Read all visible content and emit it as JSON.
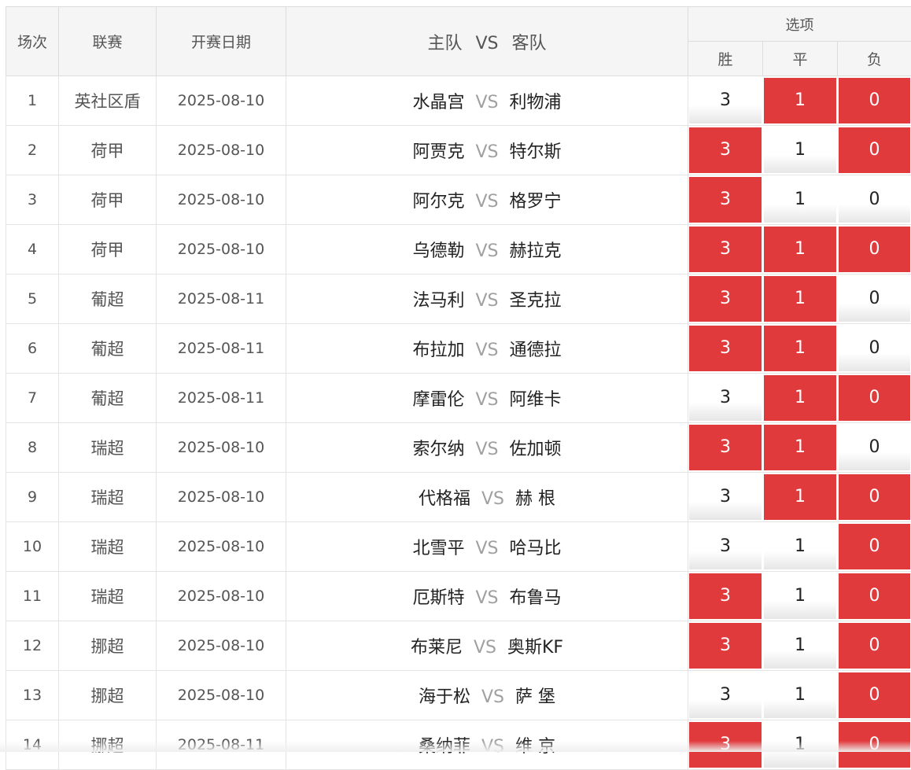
{
  "header": {
    "round": "场次",
    "league": "联赛",
    "date": "开赛日期",
    "match_home": "主队",
    "match_vs": "VS",
    "match_away": "客队",
    "options": "选项",
    "win": "胜",
    "draw": "平",
    "lose": "负"
  },
  "rows": [
    {
      "no": "1",
      "league": "英社区盾",
      "date": "2025-08-10",
      "home": "水晶宫",
      "vs": "VS",
      "away": "利物浦",
      "win": "3",
      "draw": "1",
      "lose": "0",
      "win_selected": false,
      "draw_selected": true,
      "lose_selected": true
    },
    {
      "no": "2",
      "league": "荷甲",
      "date": "2025-08-10",
      "home": "阿贾克",
      "vs": "VS",
      "away": "特尔斯",
      "win": "3",
      "draw": "1",
      "lose": "0",
      "win_selected": true,
      "draw_selected": false,
      "lose_selected": true
    },
    {
      "no": "3",
      "league": "荷甲",
      "date": "2025-08-10",
      "home": "阿尔克",
      "vs": "VS",
      "away": "格罗宁",
      "win": "3",
      "draw": "1",
      "lose": "0",
      "win_selected": true,
      "draw_selected": false,
      "lose_selected": false
    },
    {
      "no": "4",
      "league": "荷甲",
      "date": "2025-08-10",
      "home": "乌德勒",
      "vs": "VS",
      "away": "赫拉克",
      "win": "3",
      "draw": "1",
      "lose": "0",
      "win_selected": true,
      "draw_selected": true,
      "lose_selected": true
    },
    {
      "no": "5",
      "league": "葡超",
      "date": "2025-08-11",
      "home": "法马利",
      "vs": "VS",
      "away": "圣克拉",
      "win": "3",
      "draw": "1",
      "lose": "0",
      "win_selected": true,
      "draw_selected": true,
      "lose_selected": false
    },
    {
      "no": "6",
      "league": "葡超",
      "date": "2025-08-11",
      "home": "布拉加",
      "vs": "VS",
      "away": "通德拉",
      "win": "3",
      "draw": "1",
      "lose": "0",
      "win_selected": true,
      "draw_selected": true,
      "lose_selected": false
    },
    {
      "no": "7",
      "league": "葡超",
      "date": "2025-08-11",
      "home": "摩雷伦",
      "vs": "VS",
      "away": "阿维卡",
      "win": "3",
      "draw": "1",
      "lose": "0",
      "win_selected": false,
      "draw_selected": true,
      "lose_selected": true
    },
    {
      "no": "8",
      "league": "瑞超",
      "date": "2025-08-10",
      "home": "索尔纳",
      "vs": "VS",
      "away": "佐加顿",
      "win": "3",
      "draw": "1",
      "lose": "0",
      "win_selected": true,
      "draw_selected": true,
      "lose_selected": false
    },
    {
      "no": "9",
      "league": "瑞超",
      "date": "2025-08-10",
      "home": "代格福",
      "vs": "VS",
      "away": "赫 根",
      "win": "3",
      "draw": "1",
      "lose": "0",
      "win_selected": false,
      "draw_selected": true,
      "lose_selected": true
    },
    {
      "no": "10",
      "league": "瑞超",
      "date": "2025-08-10",
      "home": "北雪平",
      "vs": "VS",
      "away": "哈马比",
      "win": "3",
      "draw": "1",
      "lose": "0",
      "win_selected": false,
      "draw_selected": false,
      "lose_selected": true
    },
    {
      "no": "11",
      "league": "瑞超",
      "date": "2025-08-10",
      "home": "厄斯特",
      "vs": "VS",
      "away": "布鲁马",
      "win": "3",
      "draw": "1",
      "lose": "0",
      "win_selected": true,
      "draw_selected": false,
      "lose_selected": true
    },
    {
      "no": "12",
      "league": "挪超",
      "date": "2025-08-10",
      "home": "布莱尼",
      "vs": "VS",
      "away": "奥斯KF",
      "win": "3",
      "draw": "1",
      "lose": "0",
      "win_selected": true,
      "draw_selected": false,
      "lose_selected": true
    },
    {
      "no": "13",
      "league": "挪超",
      "date": "2025-08-10",
      "home": "海于松",
      "vs": "VS",
      "away": "萨 堡",
      "win": "3",
      "draw": "1",
      "lose": "0",
      "win_selected": false,
      "draw_selected": false,
      "lose_selected": true
    },
    {
      "no": "14",
      "league": "挪超",
      "date": "2025-08-11",
      "home": "桑纳菲",
      "vs": "VS",
      "away": "维 京",
      "win": "3",
      "draw": "1",
      "lose": "0",
      "win_selected": true,
      "draw_selected": false,
      "lose_selected": true
    }
  ],
  "colors": {
    "selected": "#e03a3c",
    "header_bg": "#f5f5f5",
    "vs_text": "#a0a0a0"
  }
}
